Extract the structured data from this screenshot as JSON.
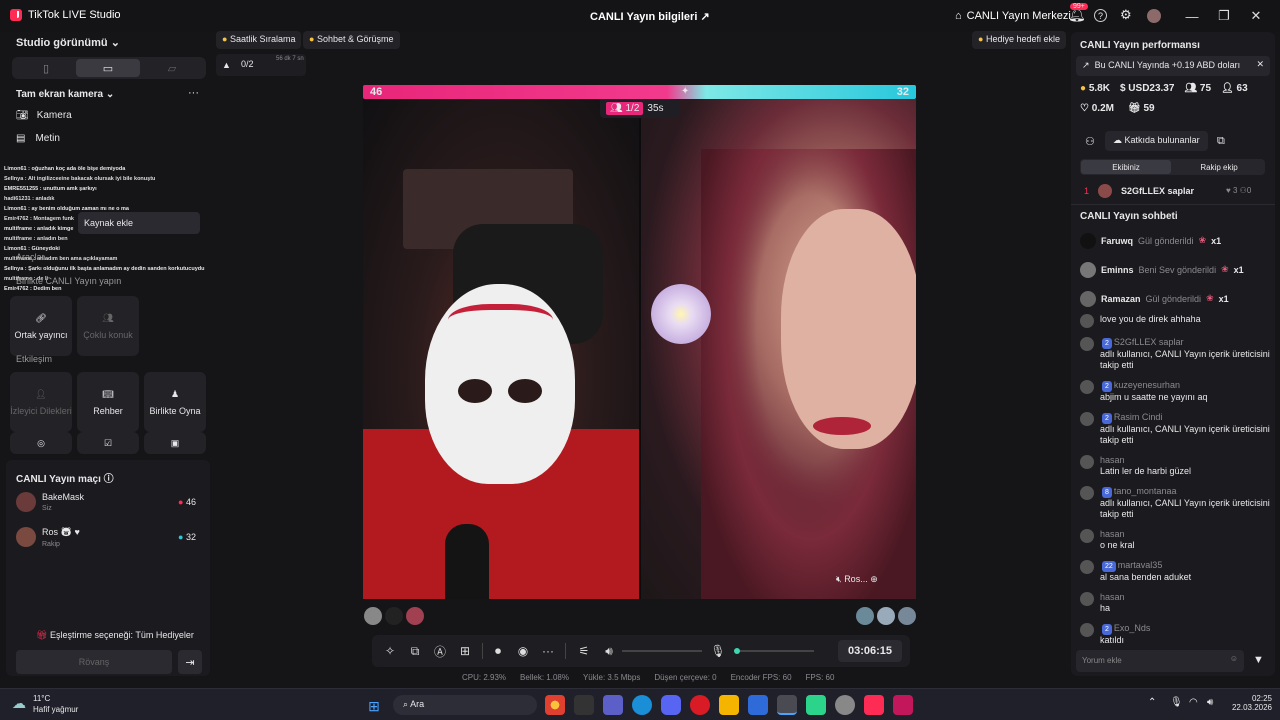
{
  "app": {
    "title": "TikTok LIVE Studio",
    "center_title": "CANLI Yayın bilgileri",
    "live_center": "CANLI Yayın Merkezi",
    "notif": "99+"
  },
  "left": {
    "studio_view": "Studio görünümü",
    "camera_mode": "Tam ekran kamera",
    "source_camera": "Kamera",
    "source_text": "Metin",
    "add_source": "Kaynak ekle",
    "tools_label": "Araçlar",
    "together_label": "Birlikte CANLI Yayın yapın",
    "btn_cohost": "Ortak yayıncı",
    "btn_multi": "Çoklu konuk",
    "interaction": "Etkileşim",
    "btn_viewer": "İzleyici Dilekleri",
    "btn_guide": "Rehber",
    "btn_play": "Birlikte Oyna",
    "match_title": "CANLI Yayın maçı",
    "p1_name": "BakeMask",
    "p1_sub": "Siz",
    "p1_score": "46",
    "p2_name": "Ros",
    "p2_sub": "Rakip",
    "p2_score": "32",
    "match_pref": "Eşleştirme seçeneği: Tüm Hediyeler",
    "rematch": "Rövanş",
    "overlay_chat": [
      "Limon61 : oğuzhan koç ada öle bişe demiyoda",
      "Sellnya : Alt ingilizceeine bakacak olursak iyi bile konuştu",
      "EMRE551255 : unuttum amk şarkıyı",
      "hadi61231 : anladık",
      "Limon61 : ay benim olduğum zaman mı ne o ma",
      "Emir4762 : Montagem funk",
      "multiframe : anladık kimge",
      "multiframe : anladın ben",
      "Limon61 : Güneydoki",
      "multiframe : anladım ben ama açıklayamam",
      "Sellnya : Şarkı olduğunu ilk başta anlamadım ay dedin sanden korkutucuydu",
      "multiframe : de li",
      "Emir4762 : Dedim ben"
    ]
  },
  "top": {
    "chip1": "Saatlik Sıralama",
    "chip2": "Sohbet & Görüşme",
    "gift_goal": "Hediye hedefi ekle",
    "counter": "0/2",
    "counter_time": "56 dk 7 sn"
  },
  "battle": {
    "score_left": "46",
    "score_right": "32",
    "round": "1/2",
    "timer": "35s",
    "right_name": "Ros..."
  },
  "controls": {
    "time": "03:06:15"
  },
  "stats": {
    "cpu": "CPU: 2.93%",
    "memory": "Bellek: 1.08%",
    "upload": "Yükle: 3.5 Mbps",
    "dropped": "Düşen çerçeve: 0",
    "encoder": "Encoder FPS: 60",
    "fps": "FPS: 60"
  },
  "right": {
    "perf_title": "CANLI Yayın performansı",
    "banner": "Bu CANLI Yayında +0.19 ABD doları",
    "s1": "5.8K",
    "s2": "USD23.37",
    "s3": "75",
    "s4": "63",
    "s5": "0.2M",
    "s6": "59",
    "contributors": "Katkıda bulunanlar",
    "tab_team": "Ekibiniz",
    "tab_rival": "Rakip ekip",
    "rank1": "1",
    "rank1_name": "S2GfLLEX saplar",
    "rank1_a": "3",
    "rank1_b": "0",
    "chat_title": "CANLI Yayın sohbeti",
    "gifts": [
      {
        "user": "Faruwq",
        "text": "Gül gönderildi",
        "count": "x1"
      },
      {
        "user": "Eminns",
        "text": "Beni Sev gönderildi",
        "count": "x1"
      },
      {
        "user": "Ramazan",
        "text": "Gül gönderildi",
        "count": "x1"
      }
    ],
    "chat": [
      {
        "user": "",
        "badge": "",
        "msg": "love you de direk ahhaha"
      },
      {
        "user": "S2GfLLEX saplar",
        "badge": "2",
        "msg": "adlı kullanıcı, CANLI Yayın içerik üreticisini takip etti"
      },
      {
        "user": "kuzeyenesurhan",
        "badge": "2",
        "msg": "abjim u saatte ne yayını aq"
      },
      {
        "user": "Rasim Cindi",
        "badge": "2",
        "msg": "adlı kullanıcı, CANLI Yayın içerik üreticisini takip etti"
      },
      {
        "user": "hasan",
        "badge": "",
        "msg": "Latin ler de harbi güzel"
      },
      {
        "user": "tano_montanaa",
        "badge": "8",
        "msg": "adlı kullanıcı, CANLI Yayın içerik üreticisini takip etti"
      },
      {
        "user": "hasan",
        "badge": "",
        "msg": "o ne kral"
      },
      {
        "user": "martaval35",
        "badge": "22",
        "msg": "al sana benden aduket"
      },
      {
        "user": "hasan",
        "badge": "",
        "msg": "ha"
      },
      {
        "user": "Exo_Nds",
        "badge": "2",
        "msg": "katıldı"
      }
    ],
    "comment_placeholder": "Yorum ekle"
  },
  "taskbar": {
    "temp": "11°C",
    "weather": "Hafif yağmur",
    "search": "Ara",
    "time": "02:25",
    "date": "22.03.2026"
  }
}
